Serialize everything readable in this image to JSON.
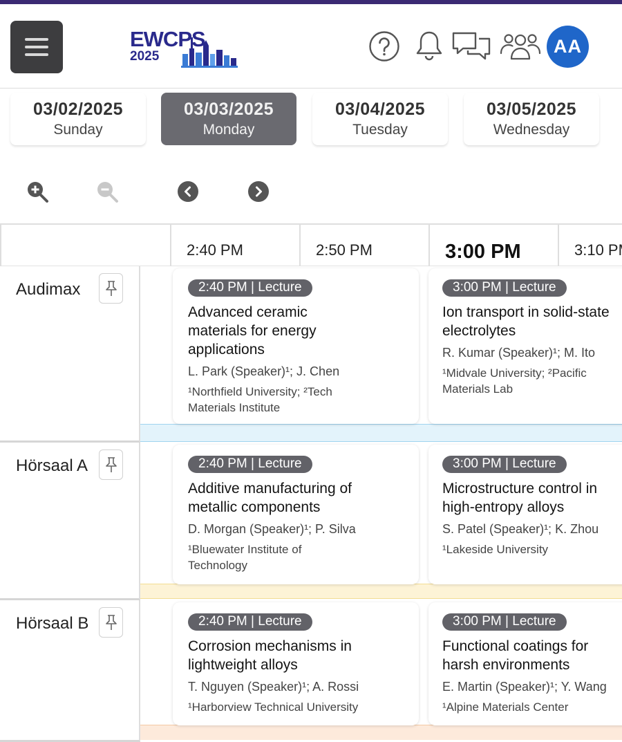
{
  "header": {
    "logo": {
      "name": "EWCPS",
      "year": "2025"
    },
    "avatar_initials": "AA",
    "icons": [
      "help-icon",
      "bell-icon",
      "chat-icon",
      "people-icon"
    ]
  },
  "dates": [
    {
      "date": "03/02/2025",
      "weekday": "Sunday",
      "active": false
    },
    {
      "date": "03/03/2025",
      "weekday": "Monday",
      "active": true
    },
    {
      "date": "03/04/2025",
      "weekday": "Tuesday",
      "active": false
    },
    {
      "date": "03/05/2025",
      "weekday": "Wednesday",
      "active": false
    }
  ],
  "times": [
    "2:40 PM",
    "2:50 PM",
    "3:00 PM",
    "3:10 PM"
  ],
  "current_time": "3:00 PM",
  "colors": {
    "accent": "#3b2a73",
    "avatar": "#1f66c9",
    "active_tab": "#6a6a70",
    "badge": "#626268"
  },
  "rooms": [
    {
      "name": "Audimax",
      "band_color": "#e3f3fb",
      "sessions": [
        {
          "badge": "2:40 PM | Lecture",
          "title_lines": [
            "Advanced ceramic",
            "materials for energy",
            "applications"
          ],
          "authors": "L. Park (Speaker)¹; J. Chen",
          "affiliation_lines": [
            "¹Northfield University; ²Tech",
            "Materials Institute"
          ]
        },
        {
          "badge": "3:00 PM | Lecture",
          "title_lines": [
            "Ion transport in solid-state",
            "electrolytes"
          ],
          "authors": "R. Kumar (Speaker)¹; M. Ito",
          "affiliation_lines": [
            "¹Midvale University; ²Pacific",
            "Materials Lab"
          ]
        }
      ]
    },
    {
      "name": "Hörsaal A",
      "band_color": "#fdf3d6",
      "sessions": [
        {
          "badge": "2:40 PM | Lecture",
          "title_lines": [
            "Additive manufacturing of",
            "metallic components"
          ],
          "authors": "D. Morgan (Speaker)¹; P. Silva",
          "affiliation_lines": [
            "¹Bluewater Institute of",
            "Technology"
          ]
        },
        {
          "badge": "3:00 PM | Lecture",
          "title_lines": [
            "Microstructure control in",
            "high-entropy alloys"
          ],
          "authors": "S. Patel (Speaker)¹; K. Zhou",
          "affiliation_lines": [
            "¹Lakeside University"
          ]
        }
      ]
    },
    {
      "name": "Hörsaal B",
      "band_color": "#fdeadb",
      "sessions": [
        {
          "badge": "2:40 PM | Lecture",
          "title_lines": [
            "Corrosion mechanisms in",
            "lightweight alloys"
          ],
          "authors": "T. Nguyen (Speaker)¹; A. Rossi",
          "affiliation_lines": [
            "¹Harborview Technical University"
          ]
        },
        {
          "badge": "3:00 PM | Lecture",
          "title_lines": [
            "Functional coatings for",
            "harsh environments"
          ],
          "authors": "E. Martin (Speaker)¹; Y. Wang",
          "affiliation_lines": [
            "¹Alpine Materials Center"
          ]
        }
      ]
    }
  ]
}
